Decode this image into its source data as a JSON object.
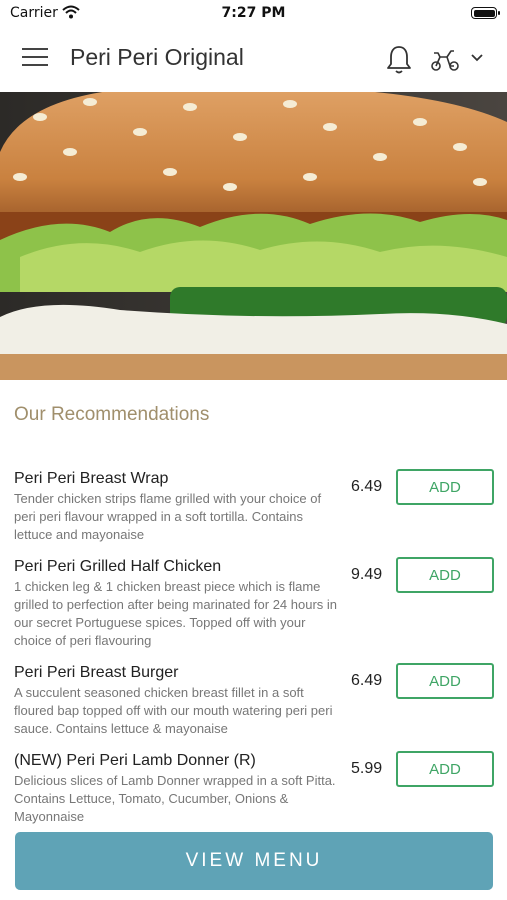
{
  "status_bar": {
    "carrier": "Carrier",
    "time": "7:27 PM"
  },
  "nav": {
    "title": "Peri Peri Original"
  },
  "section": {
    "title": "Our Recommendations"
  },
  "items": [
    {
      "name": "Peri Peri Breast Wrap",
      "description": "Tender chicken strips flame grilled with your choice of peri peri flavour wrapped in a soft tortilla. Contains lettuce and mayonaise",
      "price": "6.49",
      "add_label": "ADD"
    },
    {
      "name": "Peri Peri Grilled Half Chicken",
      "description": "1 chicken leg & 1 chicken breast piece which is flame grilled to perfection after being marinated for 24 hours in our secret Portuguese spices. Topped off with your choice of peri flavouring",
      "price": "9.49",
      "add_label": "ADD"
    },
    {
      "name": "Peri Peri Breast Burger",
      "description": "A succulent seasoned chicken breast fillet in a soft floured bap topped off with our mouth watering peri peri sauce. Contains lettuce & mayonaise",
      "price": "6.49",
      "add_label": "ADD"
    },
    {
      "name": "(NEW) Peri Peri Lamb Donner (R)",
      "description": "Delicious slices of Lamb Donner wrapped in a soft Pitta. Contains Lettuce, Tomato, Cucumber, Onions & Mayonnaise",
      "price": "5.99",
      "add_label": "ADD"
    }
  ],
  "footer": {
    "view_menu_label": "VIEW MENU"
  },
  "colors": {
    "accent_green": "#3fa565",
    "button_blue": "#5fa3b6",
    "section_title": "#a08f6c"
  },
  "icons": {
    "menu": "hamburger-icon",
    "notifications": "bell-icon",
    "delivery": "scooter-icon",
    "dropdown": "chevron-down-icon"
  }
}
